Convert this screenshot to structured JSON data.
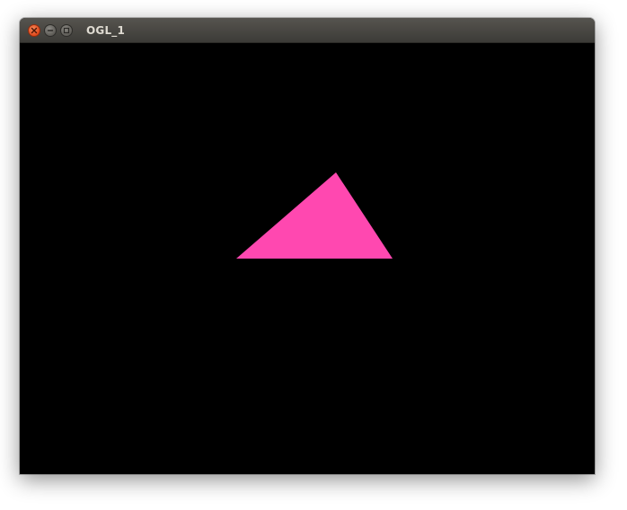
{
  "window": {
    "title": "OGL_1"
  },
  "titlebar_buttons": [
    {
      "name": "close",
      "icon": "close-icon",
      "color": "#e0491c"
    },
    {
      "name": "minimize",
      "icon": "minimize-icon",
      "color": "#5e5c57"
    },
    {
      "name": "maximize",
      "icon": "maximize-icon",
      "color": "#5e5c57"
    }
  ],
  "scene": {
    "background_color": "#000000",
    "shape": "triangle",
    "fill_color": "#ff48b0"
  }
}
